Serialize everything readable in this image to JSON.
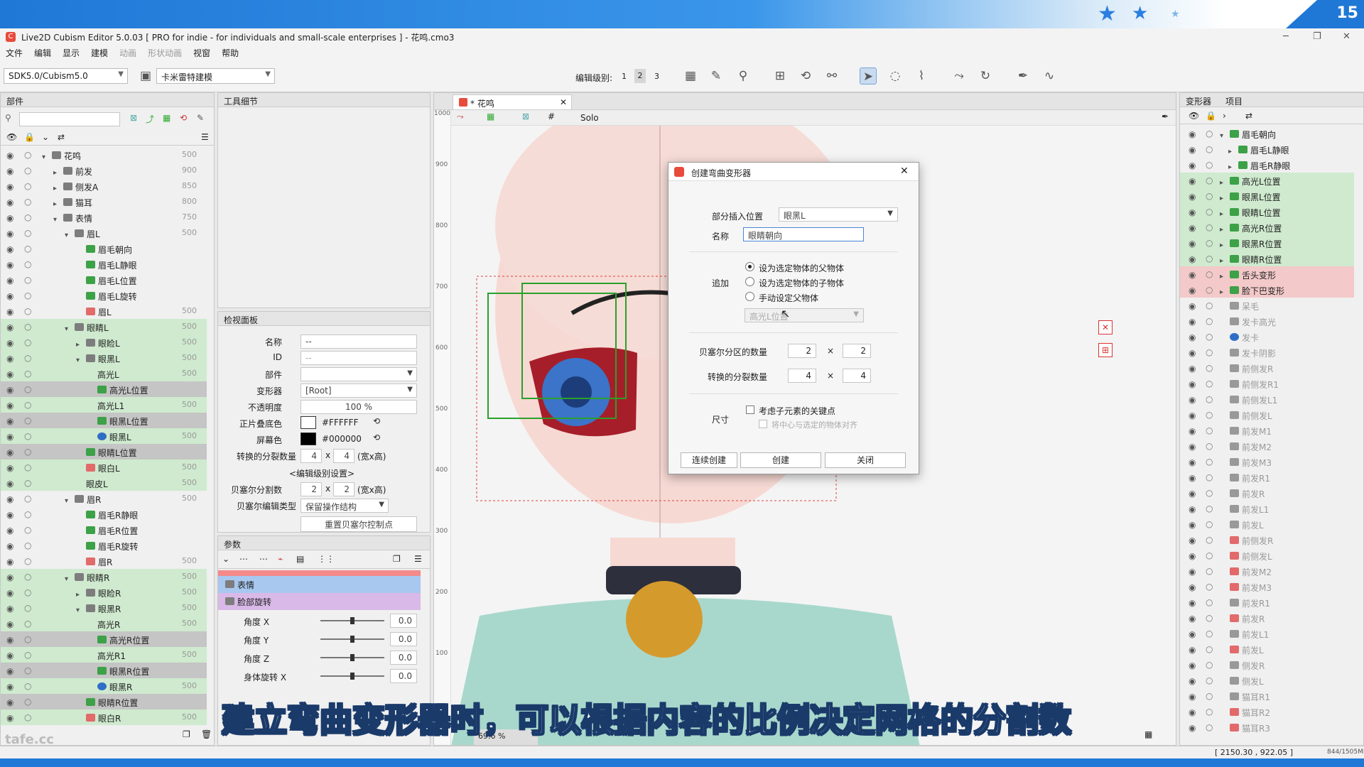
{
  "banner": {
    "slide_number": "15"
  },
  "window": {
    "title": "Live2D Cubism Editor 5.0.03    [ PRO for indie - for individuals and small-scale enterprises ] - 花鸣.cmo3"
  },
  "menu": {
    "items": [
      "文件",
      "编辑",
      "显示",
      "建模"
    ],
    "dim_items": [
      "动画",
      "形状动画"
    ],
    "items2": [
      "视窗",
      "帮助"
    ]
  },
  "toolbar": {
    "sdk_select": "SDK5.0/Cubism5.0",
    "mode_select": "卡米雷特建模",
    "edit_level_label": "编辑级别:",
    "edit_levels": [
      "1",
      "2",
      "3"
    ],
    "active_level": "2"
  },
  "parts_panel": {
    "tab_label": "部件",
    "rows": [
      {
        "label": "花鸣",
        "val": "500",
        "indent": 1,
        "icon": "folder",
        "fold": "▾",
        "state": ""
      },
      {
        "label": "前发",
        "val": "900",
        "indent": 2,
        "icon": "folder",
        "fold": "▸",
        "state": ""
      },
      {
        "label": "侧发A",
        "val": "850",
        "indent": 2,
        "icon": "folder",
        "fold": "▸",
        "state": ""
      },
      {
        "label": "猫耳",
        "val": "800",
        "indent": 2,
        "icon": "folder",
        "fold": "▸",
        "state": ""
      },
      {
        "label": "表情",
        "val": "750",
        "indent": 2,
        "icon": "folder",
        "fold": "▾",
        "state": ""
      },
      {
        "label": "眉L",
        "val": "500",
        "indent": 3,
        "icon": "folder",
        "fold": "▾",
        "state": ""
      },
      {
        "label": "眉毛朝向",
        "val": "",
        "indent": 4,
        "icon": "deform",
        "fold": "",
        "state": ""
      },
      {
        "label": "眉毛L静眼",
        "val": "",
        "indent": 4,
        "icon": "deform",
        "fold": "",
        "state": ""
      },
      {
        "label": "眉毛L位置",
        "val": "",
        "indent": 4,
        "icon": "deform",
        "fold": "",
        "state": ""
      },
      {
        "label": "眉毛L旋转",
        "val": "",
        "indent": 4,
        "icon": "deform",
        "fold": "",
        "state": ""
      },
      {
        "label": "眉L",
        "val": "500",
        "indent": 4,
        "icon": "art2",
        "fold": "",
        "state": ""
      },
      {
        "label": "眼睛L",
        "val": "500",
        "indent": 3,
        "icon": "folder",
        "fold": "▾",
        "state": "gr"
      },
      {
        "label": "眼睑L",
        "val": "500",
        "indent": 4,
        "icon": "folder",
        "fold": "▸",
        "state": "gr"
      },
      {
        "label": "眼黑L",
        "val": "500",
        "indent": 4,
        "icon": "folder",
        "fold": "▾",
        "state": "gr"
      },
      {
        "label": "高光L",
        "val": "500",
        "indent": 5,
        "icon": "",
        "fold": "",
        "state": "gr"
      },
      {
        "label": "高光L位置",
        "val": "",
        "indent": 5,
        "icon": "deform",
        "fold": "",
        "state": "sel"
      },
      {
        "label": "高光L1",
        "val": "500",
        "indent": 5,
        "icon": "",
        "fold": "",
        "state": "gr"
      },
      {
        "label": "眼黑L位置",
        "val": "",
        "indent": 5,
        "icon": "deform",
        "fold": "",
        "state": "sel"
      },
      {
        "label": "眼黑L",
        "val": "500",
        "indent": 5,
        "icon": "art",
        "fold": "",
        "state": "gr"
      },
      {
        "label": "眼睛L位置",
        "val": "",
        "indent": 4,
        "icon": "deform",
        "fold": "",
        "state": "sel"
      },
      {
        "label": "眼白L",
        "val": "500",
        "indent": 4,
        "icon": "art2",
        "fold": "",
        "state": "gr"
      },
      {
        "label": "眼皮L",
        "val": "500",
        "indent": 4,
        "icon": "",
        "fold": "",
        "state": "gr"
      },
      {
        "label": "眉R",
        "val": "500",
        "indent": 3,
        "icon": "folder",
        "fold": "▾",
        "state": ""
      },
      {
        "label": "眉毛R静眼",
        "val": "",
        "indent": 4,
        "icon": "deform",
        "fold": "",
        "state": ""
      },
      {
        "label": "眉毛R位置",
        "val": "",
        "indent": 4,
        "icon": "deform",
        "fold": "",
        "state": ""
      },
      {
        "label": "眉毛R旋转",
        "val": "",
        "indent": 4,
        "icon": "deform",
        "fold": "",
        "state": ""
      },
      {
        "label": "眉R",
        "val": "500",
        "indent": 4,
        "icon": "art2",
        "fold": "",
        "state": ""
      },
      {
        "label": "眼睛R",
        "val": "500",
        "indent": 3,
        "icon": "folder",
        "fold": "▾",
        "state": "gr"
      },
      {
        "label": "眼睑R",
        "val": "500",
        "indent": 4,
        "icon": "folder",
        "fold": "▸",
        "state": "gr"
      },
      {
        "label": "眼黑R",
        "val": "500",
        "indent": 4,
        "icon": "folder",
        "fold": "▾",
        "state": "gr"
      },
      {
        "label": "高光R",
        "val": "500",
        "indent": 5,
        "icon": "",
        "fold": "",
        "state": "gr"
      },
      {
        "label": "高光R位置",
        "val": "",
        "indent": 5,
        "icon": "deform",
        "fold": "",
        "state": "sel"
      },
      {
        "label": "高光R1",
        "val": "500",
        "indent": 5,
        "icon": "",
        "fold": "",
        "state": "gr"
      },
      {
        "label": "眼黑R位置",
        "val": "",
        "indent": 5,
        "icon": "deform",
        "fold": "",
        "state": "sel"
      },
      {
        "label": "眼黑R",
        "val": "500",
        "indent": 5,
        "icon": "art",
        "fold": "",
        "state": "gr"
      },
      {
        "label": "眼睛R位置",
        "val": "",
        "indent": 4,
        "icon": "deform",
        "fold": "",
        "state": "sel"
      },
      {
        "label": "眼白R",
        "val": "500",
        "indent": 4,
        "icon": "art2",
        "fold": "",
        "state": "gr"
      }
    ]
  },
  "tool_details": {
    "tab_label": "工具细节"
  },
  "inspector": {
    "tab_label": "检视面板",
    "name_label": "名称",
    "name_value": "--",
    "id_label": "ID",
    "id_value": "--",
    "part_label": "部件",
    "part_value": "",
    "deformer_label": "变形器",
    "deformer_value": "[Root]",
    "opacity_label": "不透明度",
    "opacity_value": "100 %",
    "multiply_label": "正片叠底色",
    "multiply_value": "#FFFFFF",
    "screen_label": "屏幕色",
    "screen_value": "#000000",
    "conv_label": "转换的分裂数量",
    "conv_x": "4",
    "conv_y": "4",
    "conv_unit": "(宽x高)",
    "level_setting": "<编辑级别设置>",
    "bezier_label": "贝塞尔分割数",
    "bezier_x": "2",
    "bezier_y": "2",
    "bezier_unit": "(宽x高)",
    "bezier_type_label": "贝塞尔编辑类型",
    "bezier_type_value": "保留操作结构",
    "reset_button": "重置贝塞尔控制点",
    "times": "x"
  },
  "params": {
    "tab_label": "参数",
    "groups": [
      "表情",
      "脸部旋转"
    ],
    "rows": [
      {
        "name": "角度 X",
        "value": "0.0"
      },
      {
        "name": "角度 Y",
        "value": "0.0"
      },
      {
        "name": "角度 Z",
        "value": "0.0"
      },
      {
        "name": "身体旋转  X",
        "value": "0.0"
      }
    ]
  },
  "viewport": {
    "tab_label": "* 花鸣",
    "solo_label": "Solo",
    "ruler_marks": [
      "1000",
      "900",
      "800",
      "700",
      "600",
      "500",
      "400",
      "300",
      "200",
      "100"
    ],
    "zoom": "69.6 %"
  },
  "dialog": {
    "title": "创建弯曲变形器",
    "insert_label": "部分插入位置",
    "insert_value": "眼黑L",
    "name_label": "名称",
    "name_value": "眼睛朝向",
    "add_label": "追加",
    "radio1": "设为选定物体的父物体",
    "radio2": "设为选定物体的子物体",
    "radio3": "手动设定父物体",
    "parent_placeholder": "高光L位置",
    "bezier_label": "贝塞尔分区的数量",
    "bezier_x": "2",
    "bezier_y": "2",
    "conv_label": "转换的分裂数量",
    "conv_x": "4",
    "conv_y": "4",
    "times": "×",
    "size_label": "尺寸",
    "check1": "考虑子元素的关键点",
    "check2": "将中心与选定的物体对齐",
    "btn_continuous": "连续创建",
    "btn_create": "创建",
    "btn_close": "关闭"
  },
  "deformer_panel": {
    "tab1": "变形器",
    "tab2": "项目",
    "rows": [
      {
        "label": "眉毛朝向",
        "indent": 1,
        "icon": "deform",
        "fold": "▾",
        "state": ""
      },
      {
        "label": "眉毛L静眼",
        "indent": 2,
        "icon": "deform",
        "fold": "▸",
        "state": ""
      },
      {
        "label": "眉毛R静眼",
        "indent": 2,
        "icon": "deform",
        "fold": "▸",
        "state": ""
      },
      {
        "label": "高光L位置",
        "indent": 1,
        "icon": "deform",
        "fold": "▸",
        "state": "gr"
      },
      {
        "label": "眼黑L位置",
        "indent": 1,
        "icon": "deform",
        "fold": "▸",
        "state": "gr"
      },
      {
        "label": "眼睛L位置",
        "indent": 1,
        "icon": "deform",
        "fold": "▸",
        "state": "gr"
      },
      {
        "label": "高光R位置",
        "indent": 1,
        "icon": "deform",
        "fold": "▸",
        "state": "gr"
      },
      {
        "label": "眼黑R位置",
        "indent": 1,
        "icon": "deform",
        "fold": "▸",
        "state": "gr"
      },
      {
        "label": "眼睛R位置",
        "indent": 1,
        "icon": "deform",
        "fold": "▸",
        "state": "gr"
      },
      {
        "label": "舌头变形",
        "indent": 1,
        "icon": "deform",
        "fold": "▸",
        "state": "red"
      },
      {
        "label": "脸下巴变形",
        "indent": 1,
        "icon": "deform",
        "fold": "▸",
        "state": "red"
      },
      {
        "label": "呆毛",
        "indent": 1,
        "icon": "grey",
        "fold": "",
        "state": ""
      },
      {
        "label": "发卡高光",
        "indent": 1,
        "icon": "grey",
        "fold": "",
        "state": ""
      },
      {
        "label": "发卡",
        "indent": 1,
        "icon": "art",
        "fold": "",
        "state": ""
      },
      {
        "label": "发卡阴影",
        "indent": 1,
        "icon": "grey",
        "fold": "",
        "state": ""
      },
      {
        "label": "前侧发R",
        "indent": 1,
        "icon": "grey",
        "fold": "",
        "state": ""
      },
      {
        "label": "前侧发R1",
        "indent": 1,
        "icon": "grey",
        "fold": "",
        "state": ""
      },
      {
        "label": "前侧发L1",
        "indent": 1,
        "icon": "grey",
        "fold": "",
        "state": ""
      },
      {
        "label": "前侧发L",
        "indent": 1,
        "icon": "grey",
        "fold": "",
        "state": ""
      },
      {
        "label": "前发M1",
        "indent": 1,
        "icon": "grey",
        "fold": "",
        "state": ""
      },
      {
        "label": "前发M2",
        "indent": 1,
        "icon": "grey",
        "fold": "",
        "state": ""
      },
      {
        "label": "前发M3",
        "indent": 1,
        "icon": "grey",
        "fold": "",
        "state": ""
      },
      {
        "label": "前发R1",
        "indent": 1,
        "icon": "grey",
        "fold": "",
        "state": ""
      },
      {
        "label": "前发R",
        "indent": 1,
        "icon": "grey",
        "fold": "",
        "state": ""
      },
      {
        "label": "前发L1",
        "indent": 1,
        "icon": "grey",
        "fold": "",
        "state": ""
      },
      {
        "label": "前发L",
        "indent": 1,
        "icon": "grey",
        "fold": "",
        "state": ""
      },
      {
        "label": "前侧发R",
        "indent": 1,
        "icon": "art2",
        "fold": "",
        "state": ""
      },
      {
        "label": "前侧发L",
        "indent": 1,
        "icon": "art2",
        "fold": "",
        "state": ""
      },
      {
        "label": "前发M2",
        "indent": 1,
        "icon": "art2",
        "fold": "",
        "state": ""
      },
      {
        "label": "前发M3",
        "indent": 1,
        "icon": "art2",
        "fold": "",
        "state": ""
      },
      {
        "label": "前发R1",
        "indent": 1,
        "icon": "grey",
        "fold": "",
        "state": ""
      },
      {
        "label": "前发R",
        "indent": 1,
        "icon": "art2",
        "fold": "",
        "state": ""
      },
      {
        "label": "前发L1",
        "indent": 1,
        "icon": "grey",
        "fold": "",
        "state": ""
      },
      {
        "label": "前发L",
        "indent": 1,
        "icon": "art2",
        "fold": "",
        "state": ""
      },
      {
        "label": "侧发R",
        "indent": 1,
        "icon": "grey",
        "fold": "",
        "state": ""
      },
      {
        "label": "侧发L",
        "indent": 1,
        "icon": "grey",
        "fold": "",
        "state": ""
      },
      {
        "label": "猫耳R1",
        "indent": 1,
        "icon": "grey",
        "fold": "",
        "state": ""
      },
      {
        "label": "猫耳R2",
        "indent": 1,
        "icon": "art2",
        "fold": "",
        "state": ""
      },
      {
        "label": "猫耳R3",
        "indent": 1,
        "icon": "art2",
        "fold": "",
        "state": ""
      }
    ]
  },
  "status": {
    "coords": "[ 2150.30 ,  922.05 ]",
    "memory": "844/1505MB"
  },
  "subtitle": "建立弯曲变形器时，可以根据内容的比例决定网格的分割数",
  "watermark": "tafe.cc"
}
